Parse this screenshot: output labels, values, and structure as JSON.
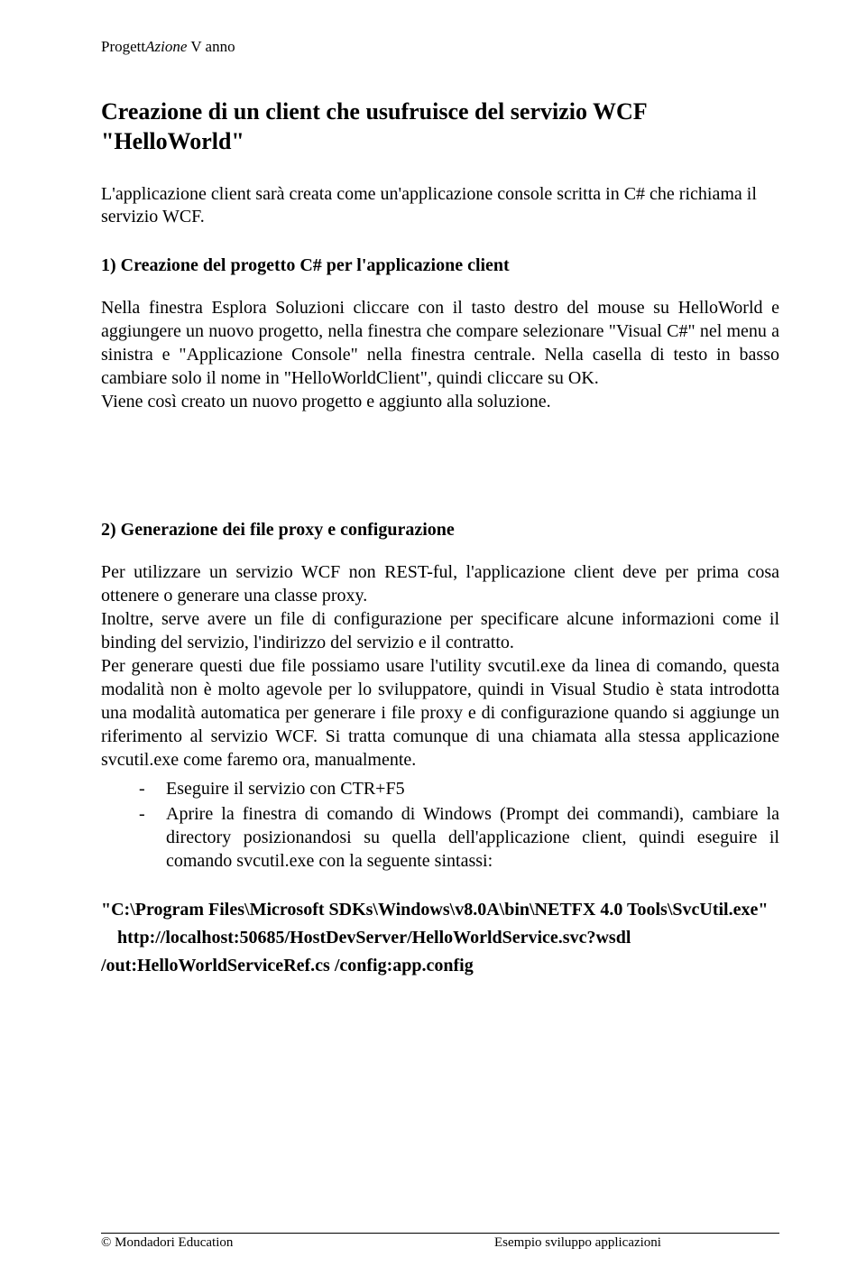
{
  "header": {
    "part1": "Progett",
    "part2": "Azione",
    "part3": " V anno"
  },
  "title": "Creazione di un client che usufruisce del servizio WCF \"HelloWorld\"",
  "intro": "L'applicazione client sarà creata come un'applicazione console scritta in C# che richiama il servizio WCF.",
  "section1": {
    "heading": "1)  Creazione del progetto C# per l'applicazione client",
    "p1": "Nella finestra Esplora Soluzioni cliccare con il tasto destro del mouse su HelloWorld e aggiungere un nuovo progetto, nella finestra che compare selezionare \"Visual C#\" nel menu a sinistra e \"Applicazione Console\" nella finestra centrale. Nella casella di testo in basso cambiare solo il nome in \"HelloWorldClient\", quindi cliccare su OK.",
    "p2": "Viene così creato un nuovo progetto e aggiunto alla soluzione."
  },
  "section2": {
    "heading": "2)  Generazione dei file proxy e configurazione",
    "p1": "Per utilizzare un servizio WCF non REST-ful, l'applicazione client deve per prima cosa ottenere o generare una classe proxy.",
    "p2": "Inoltre, serve avere un file di configurazione per specificare alcune informazioni come il binding del servizio, l'indirizzo del servizio e il contratto.",
    "p3": "Per generare questi due file possiamo usare l'utility svcutil.exe da linea di comando, questa modalità non è molto agevole per lo sviluppatore, quindi in Visual Studio è stata introdotta una modalità automatica per generare i file proxy e di configurazione quando si aggiunge un riferimento al servizio WCF. Si tratta comunque di una chiamata alla stessa applicazione svcutil.exe come faremo ora, manualmente.",
    "list": [
      "Eseguire il servizio con CTR+F5",
      "Aprire la finestra di comando di Windows (Prompt dei commandi), cambiare la directory posizionandosi su quella dell'applicazione client, quindi eseguire il comando svcutil.exe con la seguente sintassi:"
    ],
    "cmd1": "\"C:\\Program Files\\Microsoft SDKs\\Windows\\v8.0A\\bin\\NETFX 4.0 Tools\\SvcUtil.exe\"",
    "cmd2": "http://localhost:50685/HostDevServer/HelloWorldService.svc?wsdl",
    "cmd3": "/out:HelloWorldServiceRef.cs /config:app.config"
  },
  "footer": {
    "left": "© Mondadori Education",
    "center": "Esempio sviluppo applicazioni"
  }
}
